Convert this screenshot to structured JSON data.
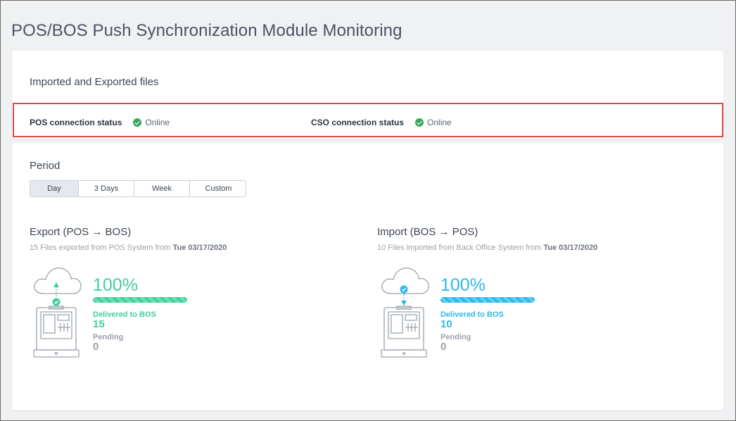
{
  "page": {
    "title": "POS/BOS Push Synchronization Module Monitoring"
  },
  "files_card": {
    "title": "Imported and Exported files"
  },
  "connection": {
    "pos": {
      "label": "POS connection status",
      "value": "Online"
    },
    "cso": {
      "label": "CSO connection status",
      "value": "Online"
    }
  },
  "period": {
    "label": "Period",
    "tabs": [
      {
        "label": "Day",
        "active": true
      },
      {
        "label": "3 Days",
        "active": false
      },
      {
        "label": "Week",
        "active": false
      },
      {
        "label": "Custom",
        "active": false
      }
    ]
  },
  "export": {
    "title": "Export (POS → BOS)",
    "subtitle": "15 Files exported from POS System from",
    "date": "Tue 03/17/2020",
    "percent_label": "100%",
    "progress": 1.0,
    "delivered_label": "Delivered to BOS",
    "delivered_value": "15",
    "pending_label": "Pending",
    "pending_value": "0",
    "color": "#3fd09a"
  },
  "import": {
    "title": "Import (BOS → POS)",
    "subtitle": "10 Files imported from Back Office System from",
    "date": "Tue 03/17/2020",
    "percent_label": "100%",
    "progress": 1.0,
    "delivered_label": "Delivered to BOS",
    "delivered_value": "10",
    "pending_label": "Pending",
    "pending_value": "0",
    "color": "#2db9ea"
  },
  "colors": {
    "online": "#3aa55d",
    "highlight_border": "#e0454d"
  },
  "icons": [
    "check-circle-icon",
    "cloud-upload-icon",
    "cloud-download-icon",
    "pos-terminal-icon"
  ]
}
